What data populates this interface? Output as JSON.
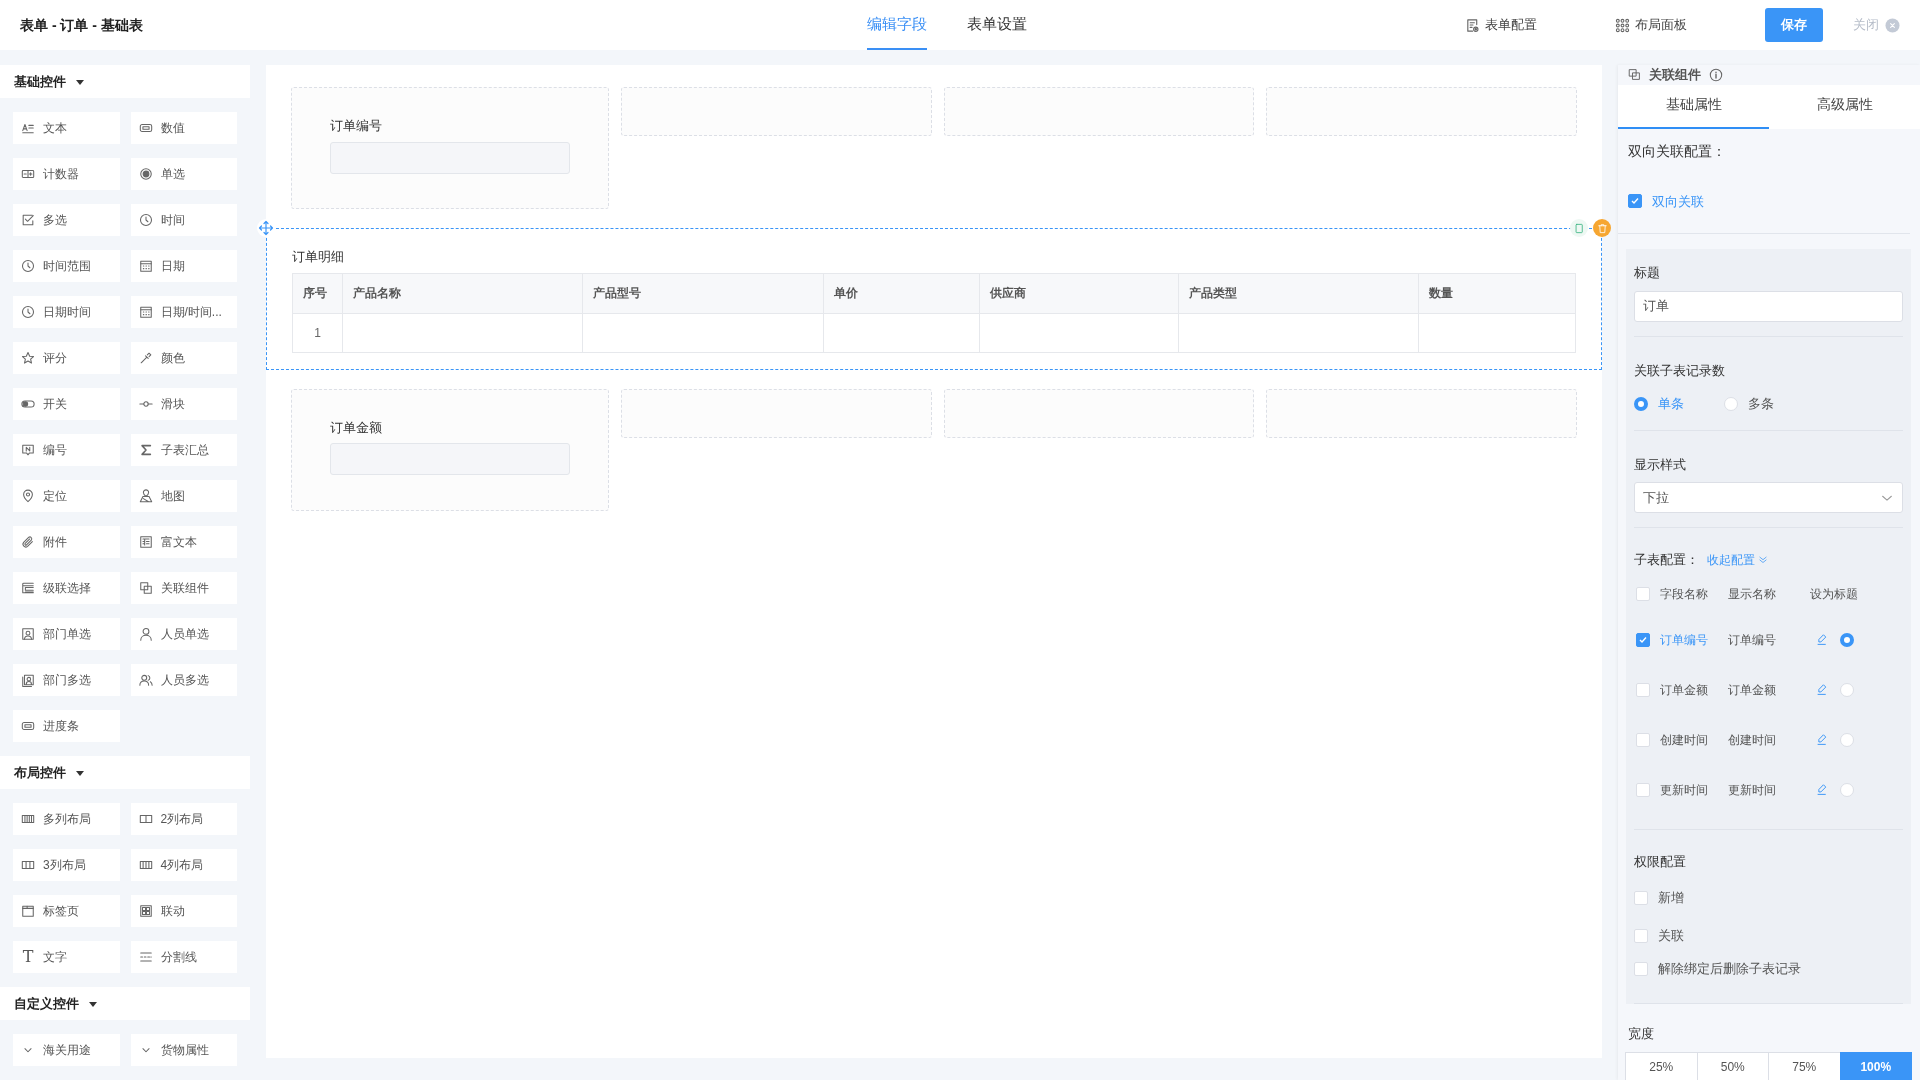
{
  "header": {
    "title": "表单 - 订单 - 基础表",
    "tabs": [
      {
        "label": "编辑字段",
        "selected": true
      },
      {
        "label": "表单设置",
        "selected": false
      }
    ],
    "actions": [
      {
        "label": "表单配置"
      },
      {
        "label": "布局面板"
      }
    ],
    "save": "保存",
    "close": "关闭"
  },
  "palette": [
    {
      "title": "基础控件",
      "expanded": true,
      "items": [
        {
          "label": "文本"
        },
        {
          "label": "数值"
        },
        {
          "label": "计数器"
        },
        {
          "label": "单选"
        },
        {
          "label": "多选"
        },
        {
          "label": "时间"
        },
        {
          "label": "时间范围"
        },
        {
          "label": "日期"
        },
        {
          "label": "日期时间"
        },
        {
          "label": "日期/时间..."
        },
        {
          "label": "评分"
        },
        {
          "label": "颜色"
        },
        {
          "label": "开关"
        },
        {
          "label": "滑块"
        },
        {
          "label": "编号"
        },
        {
          "label": "子表汇总"
        },
        {
          "label": "定位"
        },
        {
          "label": "地图"
        },
        {
          "label": "附件"
        },
        {
          "label": "富文本"
        },
        {
          "label": "级联选择"
        },
        {
          "label": "关联组件"
        },
        {
          "label": "部门单选"
        },
        {
          "label": "人员单选"
        },
        {
          "label": "部门多选"
        },
        {
          "label": "人员多选"
        },
        {
          "label": "进度条"
        }
      ]
    },
    {
      "title": "布局控件",
      "expanded": true,
      "items": [
        {
          "label": "多列布局"
        },
        {
          "label": "2列布局"
        },
        {
          "label": "3列布局"
        },
        {
          "label": "4列布局"
        },
        {
          "label": "标签页"
        },
        {
          "label": "联动"
        },
        {
          "label": "文字",
          "glyph": "T"
        },
        {
          "label": "分割线"
        }
      ]
    },
    {
      "title": "自定义控件",
      "expanded": true,
      "items": [
        {
          "label": "海关用途"
        },
        {
          "label": "货物属性"
        }
      ]
    }
  ],
  "canvas": {
    "rows": [
      {
        "kind": "fields",
        "slots": [
          {
            "kind": "field",
            "label": "订单编号"
          },
          {
            "kind": "empty"
          },
          {
            "kind": "empty"
          },
          {
            "kind": "empty"
          }
        ]
      },
      {
        "kind": "subtable",
        "selected": true,
        "title": "订单明细",
        "columns": [
          "序号",
          "产品名称",
          "产品型号",
          "单价",
          "供应商",
          "产品类型",
          "数量"
        ],
        "rows": [
          {
            "index": "1"
          }
        ]
      },
      {
        "kind": "fields",
        "slots": [
          {
            "kind": "field",
            "label": "订单金额"
          },
          {
            "kind": "empty"
          },
          {
            "kind": "empty"
          },
          {
            "kind": "empty"
          }
        ]
      }
    ]
  },
  "properties": {
    "title": "关联组件",
    "tabs": [
      {
        "label": "基础属性",
        "selected": true
      },
      {
        "label": "高级属性",
        "selected": false
      }
    ],
    "two_way_heading": "双向关联配置：",
    "two_way": {
      "label": "双向关联",
      "checked": true
    },
    "title_field": {
      "label": "标题",
      "value": "订单"
    },
    "record_count": {
      "label": "关联子表记录数",
      "options": [
        {
          "label": "单条",
          "selected": true
        },
        {
          "label": "多条",
          "selected": false
        }
      ]
    },
    "display_style": {
      "label": "显示样式",
      "value": "下拉"
    },
    "subtable_config": {
      "label": "子表配置：",
      "toggle": "收起配置",
      "columns": [
        "字段名称",
        "显示名称",
        "设为标题"
      ],
      "select_all": {
        "checked": false
      },
      "fields": [
        {
          "name": "订单编号",
          "display": "订单编号",
          "checked": true,
          "title": true
        },
        {
          "name": "订单金额",
          "display": "订单金额",
          "checked": false,
          "title": false
        },
        {
          "name": "创建时间",
          "display": "创建时间",
          "checked": false,
          "title": false
        },
        {
          "name": "更新时间",
          "display": "更新时间",
          "checked": false,
          "title": false
        }
      ]
    },
    "permissions": {
      "label": "权限配置",
      "items": [
        {
          "label": "新增",
          "checked": false
        },
        {
          "label": "关联",
          "checked": false
        },
        {
          "label": "解除绑定后删除子表记录",
          "checked": false
        }
      ]
    },
    "width": {
      "label": "宽度",
      "options": [
        {
          "label": "25%",
          "selected": false
        },
        {
          "label": "50%",
          "selected": false
        },
        {
          "label": "75%",
          "selected": false
        },
        {
          "label": "100%",
          "selected": true
        }
      ]
    }
  }
}
